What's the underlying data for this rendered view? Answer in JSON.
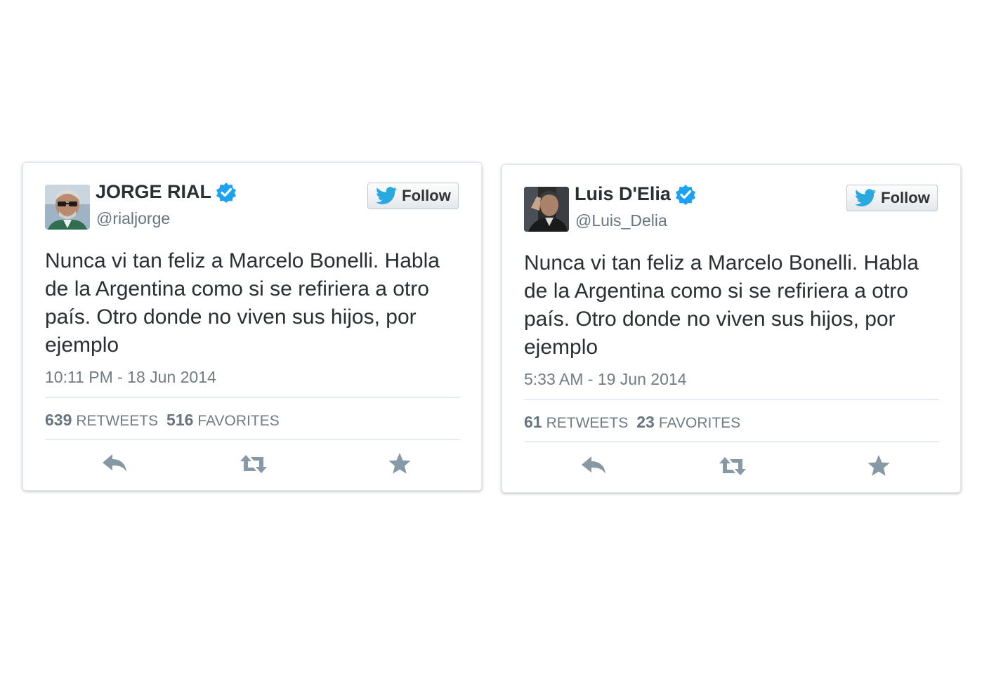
{
  "colors": {
    "verified_badge": "#1da1f2",
    "twitter_bird": "#2aa9e0",
    "text_primary": "#292f33",
    "text_secondary": "#66757f",
    "action_icon": "#8899a6"
  },
  "tweets": [
    {
      "avatar": "profile-photo-jorge-rial",
      "display_name": "JORGE RIAL",
      "verified": true,
      "handle": "@rialjorge",
      "follow_label": "Follow",
      "text": "Nunca vi tan feliz a Marcelo Bonelli. Habla de la Argentina como si se refiriera a otro país. Otro donde no viven sus hijos, por ejemplo",
      "timestamp": "10:11 PM - 18 Jun 2014",
      "retweets_count": "639",
      "retweets_label": "RETWEETS",
      "favorites_count": "516",
      "favorites_label": "FAVORITES",
      "actions": [
        "reply-icon",
        "retweet-icon",
        "favorite-star-icon"
      ]
    },
    {
      "avatar": "profile-photo-luis-delia",
      "display_name": "Luis D'Elia",
      "verified": true,
      "handle": "@Luis_Delia",
      "follow_label": "Follow",
      "text": "Nunca vi tan feliz a Marcelo Bonelli. Habla de la Argentina como si se refiriera a otro país. Otro donde no viven sus hijos, por ejemplo",
      "timestamp": "5:33 AM - 19 Jun 2014",
      "retweets_count": "61",
      "retweets_label": "RETWEETS",
      "favorites_count": "23",
      "favorites_label": "FAVORITES",
      "actions": [
        "reply-icon",
        "retweet-icon",
        "favorite-star-icon"
      ]
    }
  ]
}
